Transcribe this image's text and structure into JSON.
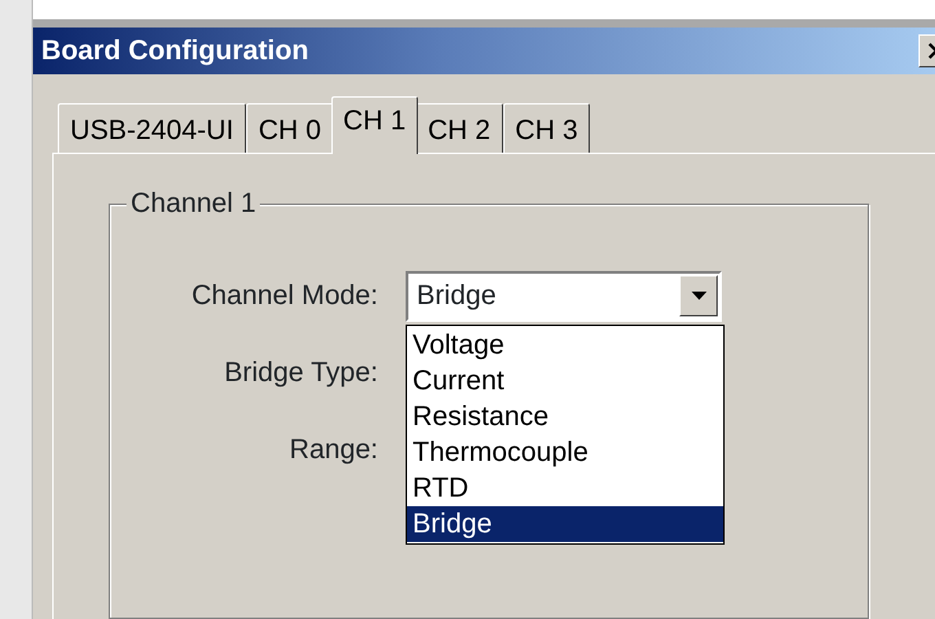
{
  "window": {
    "title": "Board Configuration"
  },
  "tabs": [
    {
      "label": "USB-2404-UI",
      "selected": false
    },
    {
      "label": "CH 0",
      "selected": false
    },
    {
      "label": "CH 1",
      "selected": true
    },
    {
      "label": "CH 2",
      "selected": false
    },
    {
      "label": "CH 3",
      "selected": false
    }
  ],
  "group": {
    "title": "Channel 1",
    "fields": [
      {
        "label": "Channel Mode:",
        "value": "Bridge",
        "expanded": true
      },
      {
        "label": "Bridge Type:"
      },
      {
        "label": "Range:"
      }
    ]
  },
  "dropdown": {
    "options": [
      {
        "label": "Voltage",
        "selected": false
      },
      {
        "label": "Current",
        "selected": false
      },
      {
        "label": "Resistance",
        "selected": false
      },
      {
        "label": "Thermocouple",
        "selected": false
      },
      {
        "label": "RTD",
        "selected": false
      },
      {
        "label": "Bridge",
        "selected": true
      }
    ]
  }
}
